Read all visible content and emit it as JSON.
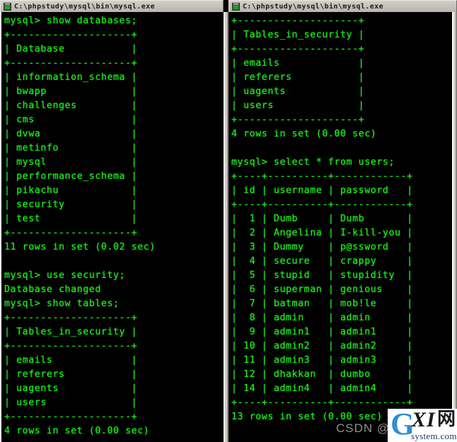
{
  "windows": {
    "left": {
      "title": "C:\\phpstudy\\mysql\\bin\\mysql.exe",
      "icon": "console-window-icon",
      "terminal_text": "mysql> show databases;\n+--------------------+\n| Database           |\n+--------------------+\n| information_schema |\n| bwapp              |\n| challenges         |\n| cms                |\n| dvwa               |\n| metinfo            |\n| mysql              |\n| performance_schema |\n| pikachu            |\n| security           |\n| test               |\n+--------------------+\n11 rows in set (0.02 sec)\n\nmysql> use security;\nDatabase changed\nmysql> show tables;\n+--------------------+\n| Tables_in_security |\n+--------------------+\n| emails             |\n| referers           |\n| uagents            |\n| users              |\n+--------------------+\n4 rows in set (0.00 sec)"
    },
    "right": {
      "title": "C:\\phpstudy\\mysql\\bin\\mysql.exe",
      "icon": "console-window-icon",
      "terminal_text": "+--------------------+\n| Tables_in_security |\n+--------------------+\n| emails             |\n| referers           |\n| uagents            |\n| users              |\n+--------------------+\n4 rows in set (0.00 sec)\n\nmysql> select * from users;\n+----+----------+------------+\n| id | username | password   |\n+----+----------+------------+\n|  1 | Dumb     | Dumb       |\n|  2 | Angelina | I-kill-you |\n|  3 | Dummy    | p@ssword   |\n|  4 | secure   | crappy     |\n|  5 | stupid   | stupidity  |\n|  6 | superman | genious    |\n|  7 | batman   | mob!le     |\n|  8 | admin    | admin      |\n|  9 | admin1   | admin1     |\n| 10 | admin2   | admin2     |\n| 11 | admin3   | admin3     |\n| 12 | dhakkan  | dumbo      |\n| 14 | admin4   | admin4     |\n+----+----------+------------+\n13 rows in set (0.00 sec)"
    }
  },
  "terminal_queries": {
    "show_databases": "show databases;",
    "use_security": "use security;",
    "show_tables": "show tables;",
    "select_users": "select * from users;"
  },
  "databases": {
    "column_header": "Database",
    "rows": [
      "information_schema",
      "bwapp",
      "challenges",
      "cms",
      "dvwa",
      "metinfo",
      "mysql",
      "performance_schema",
      "pikachu",
      "security",
      "test"
    ],
    "result_line": "11 rows in set (0.02 sec)"
  },
  "tables_in_security": {
    "column_header": "Tables_in_security",
    "rows": [
      "emails",
      "referers",
      "uagents",
      "users"
    ],
    "result_line": "4 rows in set (0.00 sec)"
  },
  "users_table": {
    "headers": [
      "id",
      "username",
      "password"
    ],
    "rows": [
      [
        "1",
        "Dumb",
        "Dumb"
      ],
      [
        "2",
        "Angelina",
        "I-kill-you"
      ],
      [
        "3",
        "Dummy",
        "p@ssword"
      ],
      [
        "4",
        "secure",
        "crappy"
      ],
      [
        "5",
        "stupid",
        "stupidity"
      ],
      [
        "6",
        "superman",
        "genious"
      ],
      [
        "7",
        "batman",
        "mob!le"
      ],
      [
        "8",
        "admin",
        "admin"
      ],
      [
        "9",
        "admin1",
        "admin1"
      ],
      [
        "10",
        "admin2",
        "admin2"
      ],
      [
        "11",
        "admin3",
        "admin3"
      ],
      [
        "12",
        "dhakkan",
        "dumbo"
      ],
      [
        "14",
        "admin4",
        "admin4"
      ]
    ],
    "result_line": "13 rows in set (0.00 sec)"
  },
  "status_messages": {
    "database_changed": "Database changed"
  },
  "watermark": {
    "csdn": "CSDN @",
    "logo_letter": "G",
    "logo_xi": "XI",
    "logo_cjk": "网",
    "logo_sub": "system.com"
  },
  "colors": {
    "terminal_text": "#19e619",
    "terminal_bg": "#000000",
    "titlebar_bg": "#d4d0c8",
    "watermark_blue": "#2f8fd0",
    "watermark_gray": "#8f8f8f"
  }
}
